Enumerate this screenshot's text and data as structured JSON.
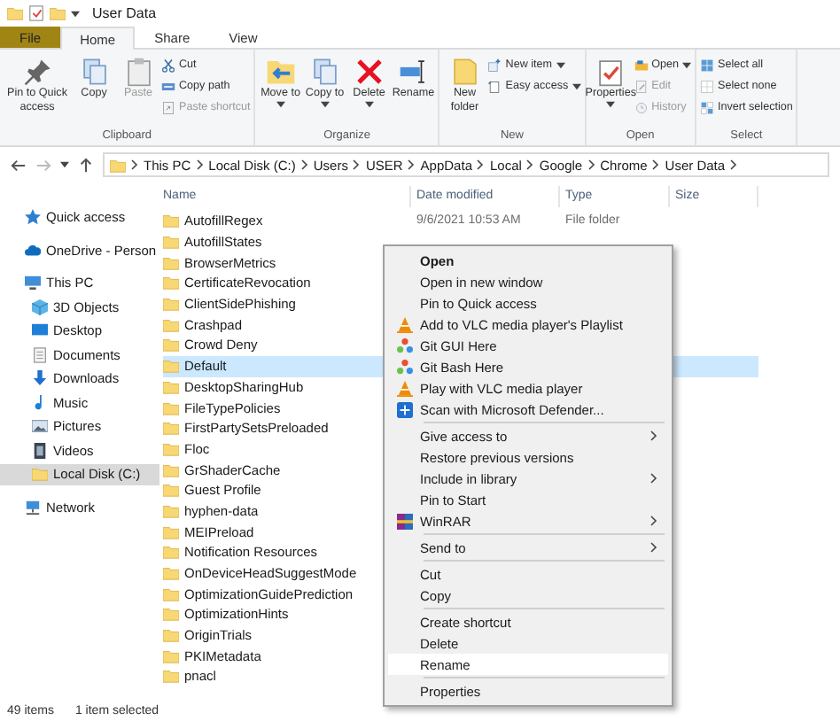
{
  "window": {
    "title": "User Data"
  },
  "ribbon_tabs": [
    {
      "label": "File",
      "kind": "file"
    },
    {
      "label": "Home",
      "kind": "tab",
      "selected": true
    },
    {
      "label": "Share",
      "kind": "tab",
      "selected": false
    },
    {
      "label": "View",
      "kind": "tab",
      "selected": false
    }
  ],
  "ribbon_groups": [
    {
      "label": "Clipboard",
      "large": [
        {
          "label": "Pin to Quick access",
          "kind": "pin",
          "disabled": false,
          "dropdown": false
        },
        {
          "label": "Copy",
          "kind": "copy",
          "disabled": false,
          "dropdown": false
        },
        {
          "label": "Paste",
          "kind": "paste",
          "disabled": true,
          "dropdown": false
        }
      ],
      "small": [
        {
          "label": "Cut",
          "kind": "cut",
          "disabled": false,
          "dropdown": false
        },
        {
          "label": "Copy path",
          "kind": "copypath",
          "disabled": false,
          "dropdown": false
        },
        {
          "label": "Paste shortcut",
          "kind": "pasteshortcut",
          "disabled": true,
          "dropdown": false
        }
      ]
    },
    {
      "label": "Organize",
      "large": [
        {
          "label": "Move to",
          "kind": "move",
          "disabled": false,
          "dropdown": true
        },
        {
          "label": "Copy to",
          "kind": "copyto",
          "disabled": false,
          "dropdown": true
        },
        {
          "label": "Delete",
          "kind": "delete",
          "disabled": false,
          "dropdown": true
        },
        {
          "label": "Rename",
          "kind": "rename",
          "disabled": false,
          "dropdown": false
        }
      ]
    },
    {
      "label": "New",
      "large": [
        {
          "label": "New folder",
          "kind": "newfolder",
          "disabled": false,
          "dropdown": false
        }
      ],
      "small": [
        {
          "label": "New item",
          "kind": "newitem",
          "disabled": false,
          "dropdown": true
        },
        {
          "label": "Easy access",
          "kind": "easyaccess",
          "disabled": false,
          "dropdown": true
        }
      ]
    },
    {
      "label": "Open",
      "large": [
        {
          "label": "Properties",
          "kind": "properties",
          "disabled": false,
          "dropdown": true
        }
      ],
      "small": [
        {
          "label": "Open",
          "kind": "open",
          "disabled": false,
          "dropdown": true
        },
        {
          "label": "Edit",
          "kind": "edit",
          "disabled": true,
          "dropdown": false
        },
        {
          "label": "History",
          "kind": "history",
          "disabled": true,
          "dropdown": false
        }
      ]
    },
    {
      "label": "Select",
      "small": [
        {
          "label": "Select all",
          "kind": "selectall",
          "disabled": false,
          "dropdown": false
        },
        {
          "label": "Select none",
          "kind": "selectnone",
          "disabled": false,
          "dropdown": false
        },
        {
          "label": "Invert selection",
          "kind": "invert",
          "disabled": false,
          "dropdown": false
        }
      ]
    }
  ],
  "address": {
    "crumbs": [
      "This PC",
      "Local Disk (C:)",
      "Users",
      "USER",
      "AppData",
      "Local",
      "Google",
      "Chrome",
      "User Data"
    ]
  },
  "nav": [
    {
      "label": "Quick access",
      "kind": "star",
      "selected": false
    },
    {
      "label": "OneDrive - Person",
      "kind": "cloud",
      "selected": false
    },
    {
      "label": "This PC",
      "kind": "pc",
      "selected": false,
      "children": [
        {
          "label": "3D Objects",
          "kind": "cube",
          "selected": false
        },
        {
          "label": "Desktop",
          "kind": "desktop",
          "selected": false
        },
        {
          "label": "Documents",
          "kind": "doc",
          "selected": false
        },
        {
          "label": "Downloads",
          "kind": "download",
          "selected": false
        },
        {
          "label": "Music",
          "kind": "music",
          "selected": false
        },
        {
          "label": "Pictures",
          "kind": "pictures",
          "selected": false
        },
        {
          "label": "Videos",
          "kind": "videos",
          "selected": false
        },
        {
          "label": "Local Disk (C:)",
          "kind": "folder",
          "selected": true
        }
      ]
    },
    {
      "label": "Network",
      "kind": "network",
      "selected": false
    }
  ],
  "columns": [
    "Name",
    "Date modified",
    "Type",
    "Size"
  ],
  "rows": [
    {
      "name": "AutofillRegex",
      "date": "9/6/2021 10:53 AM",
      "type": "File folder",
      "selected": false
    },
    {
      "name": "AutofillStates",
      "selected": false
    },
    {
      "name": "BrowserMetrics",
      "selected": false
    },
    {
      "name": "CertificateRevocation",
      "selected": false
    },
    {
      "name": "ClientSidePhishing",
      "selected": false
    },
    {
      "name": "Crashpad",
      "selected": false
    },
    {
      "name": "Crowd Deny",
      "selected": false
    },
    {
      "name": "Default",
      "selected": true
    },
    {
      "name": "DesktopSharingHub",
      "selected": false
    },
    {
      "name": "FileTypePolicies",
      "selected": false
    },
    {
      "name": "FirstPartySetsPreloaded",
      "selected": false
    },
    {
      "name": "Floc",
      "selected": false
    },
    {
      "name": "GrShaderCache",
      "selected": false
    },
    {
      "name": "Guest Profile",
      "selected": false
    },
    {
      "name": "hyphen-data",
      "selected": false
    },
    {
      "name": "MEIPreload",
      "selected": false
    },
    {
      "name": "Notification Resources",
      "selected": false
    },
    {
      "name": "OnDeviceHeadSuggestMode",
      "selected": false
    },
    {
      "name": "OptimizationGuidePrediction",
      "selected": false
    },
    {
      "name": "OptimizationHints",
      "selected": false
    },
    {
      "name": "OriginTrials",
      "selected": false
    },
    {
      "name": "PKIMetadata",
      "selected": false
    },
    {
      "name": "pnacl",
      "selected": false
    }
  ],
  "context_menu": [
    {
      "kind": "plain",
      "label": "Open",
      "bold": true,
      "submenu": false,
      "selected": false
    },
    {
      "kind": "plain",
      "label": "Open in new window",
      "bold": false,
      "submenu": false,
      "selected": false
    },
    {
      "kind": "plain",
      "label": "Pin to Quick access",
      "bold": false,
      "submenu": false,
      "selected": false
    },
    {
      "kind": "cone",
      "label": "Add to VLC media player's Playlist",
      "bold": false,
      "submenu": false,
      "selected": false
    },
    {
      "kind": "dots",
      "label": "Git GUI Here",
      "bold": false,
      "submenu": false,
      "selected": false
    },
    {
      "kind": "dots",
      "label": "Git Bash Here",
      "bold": false,
      "submenu": false,
      "selected": false
    },
    {
      "kind": "cone",
      "label": "Play with VLC media player",
      "bold": false,
      "submenu": false,
      "selected": false
    },
    {
      "kind": "shield",
      "label": "Scan with Microsoft Defender...",
      "bold": false,
      "submenu": false,
      "selected": false
    },
    {
      "kind": "separator"
    },
    {
      "kind": "plain",
      "label": "Give access to",
      "bold": false,
      "submenu": true,
      "selected": false
    },
    {
      "kind": "plain",
      "label": "Restore previous versions",
      "bold": false,
      "submenu": false,
      "selected": false
    },
    {
      "kind": "plain",
      "label": "Include in library",
      "bold": false,
      "submenu": true,
      "selected": false
    },
    {
      "kind": "plain",
      "label": "Pin to Start",
      "bold": false,
      "submenu": false,
      "selected": false
    },
    {
      "kind": "archive",
      "label": "WinRAR",
      "bold": false,
      "submenu": true,
      "selected": false
    },
    {
      "kind": "separator"
    },
    {
      "kind": "plain",
      "label": "Send to",
      "bold": false,
      "submenu": true,
      "selected": false
    },
    {
      "kind": "separator"
    },
    {
      "kind": "plain",
      "label": "Cut",
      "bold": false,
      "submenu": false,
      "selected": false
    },
    {
      "kind": "plain",
      "label": "Copy",
      "bold": false,
      "submenu": false,
      "selected": false
    },
    {
      "kind": "separator"
    },
    {
      "kind": "plain",
      "label": "Create shortcut",
      "bold": false,
      "submenu": false,
      "selected": false
    },
    {
      "kind": "plain",
      "label": "Delete",
      "bold": false,
      "submenu": false,
      "selected": false
    },
    {
      "kind": "plain",
      "label": "Rename",
      "bold": false,
      "submenu": false,
      "selected": true
    },
    {
      "kind": "separator"
    },
    {
      "kind": "plain",
      "label": "Properties",
      "bold": false,
      "submenu": false,
      "selected": false
    }
  ],
  "status": {
    "count": "49 items",
    "selection": "1 item selected"
  }
}
